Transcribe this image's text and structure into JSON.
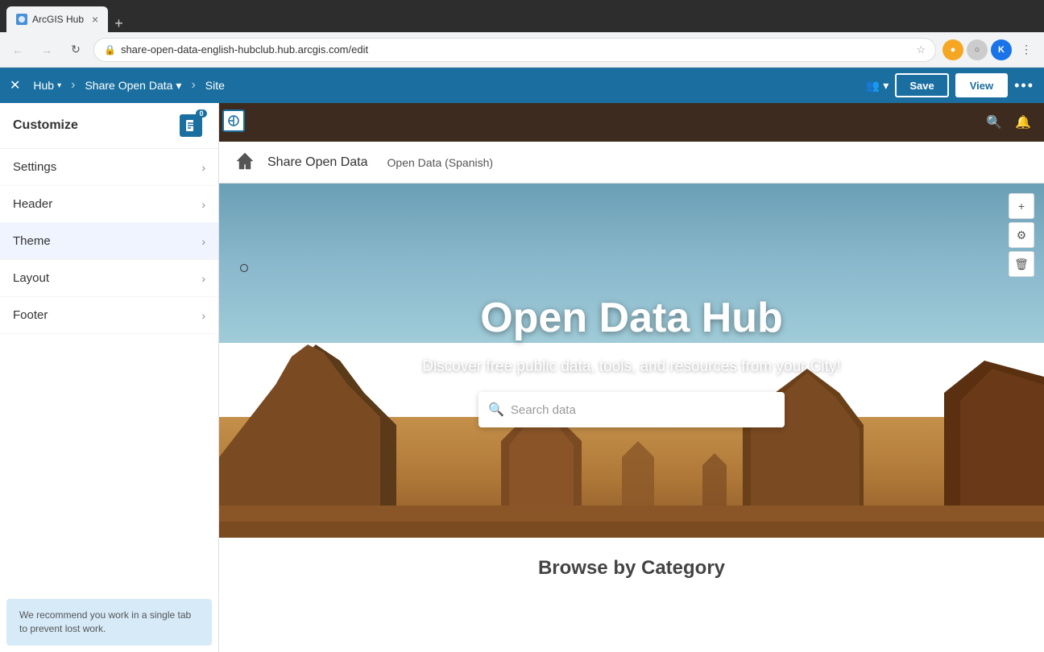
{
  "browser": {
    "tabs": [
      {
        "label": "ArcGIS Hub",
        "active": true,
        "favicon": "🌐"
      },
      {
        "label": "+",
        "active": false
      }
    ],
    "url": "share-open-data-english-hubclub.hub.arcgis.com/edit",
    "url_display": "share-open-data-english-hubclub.hub.arcgis.com/edit"
  },
  "app_header": {
    "close_label": "✕",
    "hub_label": "Hub",
    "hub_dropdown": "▾",
    "breadcrumb_sep": "›",
    "share_open_data_label": "Share Open Data",
    "share_dropdown": "▾",
    "site_label": "Site",
    "collab_icon": "👥",
    "save_label": "Save",
    "view_label": "View",
    "more_label": "•••"
  },
  "sidebar": {
    "title": "Customize",
    "doc_icon_count": "0",
    "items": [
      {
        "id": "settings",
        "label": "Settings"
      },
      {
        "id": "header",
        "label": "Header"
      },
      {
        "id": "theme",
        "label": "Theme"
      },
      {
        "id": "layout",
        "label": "Layout"
      },
      {
        "id": "footer",
        "label": "Footer"
      }
    ],
    "footer_text": "We recommend you work in a single tab to prevent lost work."
  },
  "site": {
    "navbar_bg": "#3d2b1f",
    "header": {
      "logo_alt": "logo",
      "site_name": "Share Open Data",
      "nav_item": "Open Data (Spanish)"
    },
    "hero": {
      "title": "Open Data Hub",
      "subtitle": "Discover free public data, tools, and resources from your City!",
      "search_placeholder": "Search data"
    },
    "browse": {
      "title": "Browse by Category"
    },
    "float_controls": [
      {
        "id": "add",
        "icon": "+"
      },
      {
        "id": "settings",
        "icon": "⚙"
      },
      {
        "id": "delete",
        "icon": "🗑"
      }
    ]
  },
  "icons": {
    "chevron_right": "›",
    "hamburger": "☰",
    "search": "🔍",
    "bell": "🔔",
    "back": "‹",
    "forward": "›",
    "refresh": "↻",
    "star": "☆",
    "lock": "🔒",
    "plus": "+"
  }
}
